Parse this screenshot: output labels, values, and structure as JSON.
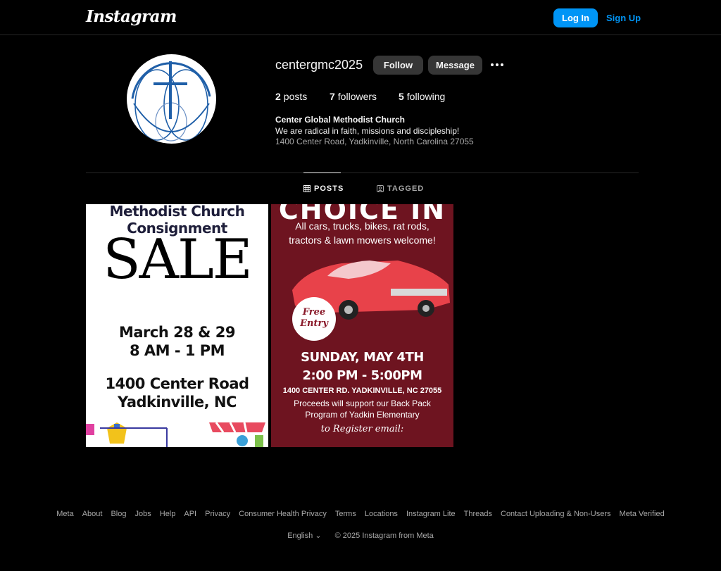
{
  "header": {
    "logo_text": "Instagram",
    "login_label": "Log In",
    "signup_label": "Sign Up"
  },
  "profile": {
    "username": "centergmc2025",
    "follow_label": "Follow",
    "message_label": "Message",
    "posts_count": "2",
    "posts_label": "posts",
    "followers_count": "7",
    "followers_label": "followers",
    "following_count": "5",
    "following_label": "following",
    "bio_name": "Center Global Methodist Church",
    "bio_text": "We are radical in faith, missions and discipleship!",
    "bio_address": "1400 Center Road, Yadkinville, North Carolina 27055"
  },
  "tabs": [
    {
      "label": "POSTS",
      "active": true
    },
    {
      "label": "TAGGED",
      "active": false
    }
  ],
  "posts": [
    {
      "line1": "Methodist Church",
      "line2": "Consignment",
      "big": "SALE",
      "dates": "March 28 & 29",
      "time": "8 AM - 1 PM",
      "address1": "1400 Center Road",
      "address2": "Yadkinville, NC"
    },
    {
      "top": "CHOICE IN",
      "line1": "All cars, trucks, bikes, rat rods,",
      "line2": "tractors & lawn mowers welcome!",
      "badge1": "Free",
      "badge2": "Entry",
      "date": "SUNDAY, MAY 4TH",
      "time": "2:00 PM - 5:00PM",
      "address": "1400 CENTER RD. YADKINVILLE, NC 27055",
      "proceeds1": "Proceeds will support our Back Pack",
      "proceeds2": "Program of Yadkin Elementary",
      "register": "to Register email:"
    }
  ],
  "footer": {
    "links": [
      "Meta",
      "About",
      "Blog",
      "Jobs",
      "Help",
      "API",
      "Privacy",
      "Consumer Health Privacy",
      "Terms",
      "Locations",
      "Instagram Lite",
      "Threads",
      "Contact Uploading & Non-Users",
      "Meta Verified"
    ],
    "language": "English",
    "copyright": "© 2025 Instagram from Meta"
  },
  "colors": {
    "accent": "#0095f6",
    "background": "#000000",
    "button_gray": "#363636"
  }
}
